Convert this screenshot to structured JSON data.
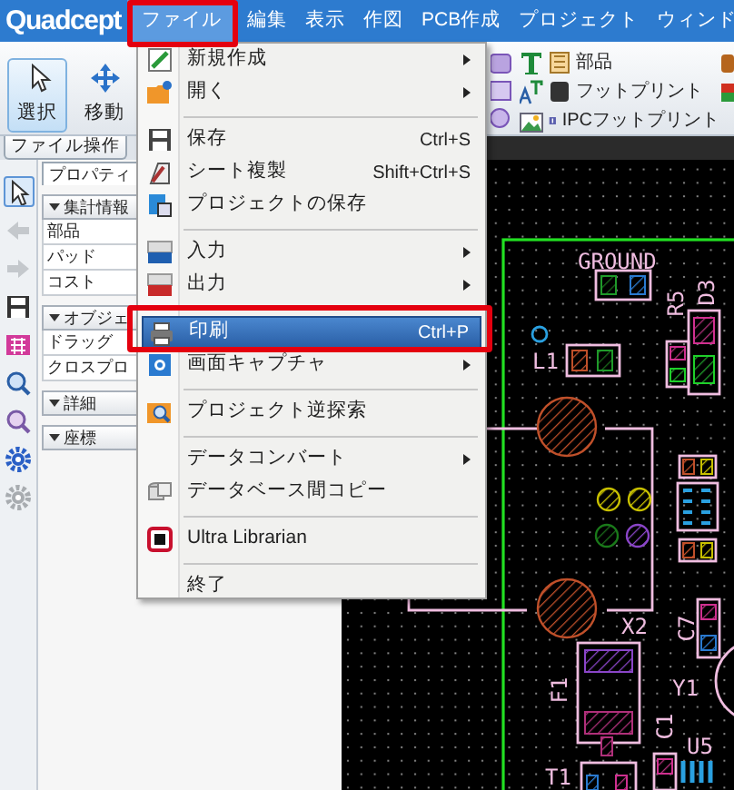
{
  "app": {
    "logo": "Quadcept"
  },
  "menubar": [
    {
      "label": "ファイル",
      "selected": true
    },
    {
      "label": "編集",
      "selected": false
    },
    {
      "label": "表示",
      "selected": false
    },
    {
      "label": "作図",
      "selected": false
    },
    {
      "label": "PCB作成",
      "selected": false
    },
    {
      "label": "プロジェクト",
      "selected": false
    },
    {
      "label": "ウィンド",
      "selected": false
    }
  ],
  "ribbon": {
    "tools": [
      {
        "kind": "select",
        "label": "選択",
        "selected": true
      },
      {
        "kind": "move",
        "label": "移動",
        "selected": false
      }
    ],
    "group_label": "ファイル操作",
    "library_items": [
      "部品",
      "フットプリント",
      "IPCフットプリント"
    ]
  },
  "side_tools": [
    {
      "kind": "pointer",
      "selected": true
    },
    {
      "kind": "back",
      "selected": false
    },
    {
      "kind": "forward",
      "selected": false
    },
    {
      "kind": "save",
      "selected": false
    },
    {
      "kind": "grid",
      "selected": false
    },
    {
      "kind": "zoom-in",
      "selected": false
    },
    {
      "kind": "zoom-out",
      "selected": false
    },
    {
      "kind": "gear",
      "selected": false
    },
    {
      "kind": "gear-dim",
      "selected": false
    }
  ],
  "panel": {
    "tab": "プロパティ",
    "sections": [
      {
        "title": "集計情報",
        "rows": [
          "部品",
          "パッド",
          "コスト"
        ]
      },
      {
        "title": "オブジェ",
        "rows": [
          "ドラッグ",
          "クロスプロ"
        ]
      },
      {
        "title": "詳細"
      },
      {
        "title": "座標"
      }
    ]
  },
  "file_menu": {
    "items": [
      {
        "kind": "item",
        "label": "新規作成",
        "submenu": true,
        "selected": false
      },
      {
        "kind": "item",
        "label": "開く",
        "submenu": true,
        "selected": false
      },
      {
        "kind": "separator"
      },
      {
        "kind": "item",
        "label": "保存",
        "shortcut": "Ctrl+S",
        "submenu": false,
        "selected": false
      },
      {
        "kind": "item",
        "label": "シート複製",
        "shortcut": "Shift+Ctrl+S",
        "submenu": false,
        "selected": false
      },
      {
        "kind": "item",
        "label": "プロジェクトの保存",
        "submenu": false,
        "selected": false
      },
      {
        "kind": "separator"
      },
      {
        "kind": "item",
        "label": "入力",
        "submenu": true,
        "selected": false
      },
      {
        "kind": "item",
        "label": "出力",
        "submenu": true,
        "selected": false
      },
      {
        "kind": "separator"
      },
      {
        "kind": "item",
        "label": "印刷",
        "shortcut": "Ctrl+P",
        "submenu": false,
        "selected": true
      },
      {
        "kind": "item",
        "label": "画面キャプチャ",
        "submenu": true,
        "selected": false
      },
      {
        "kind": "separator"
      },
      {
        "kind": "item",
        "label": "プロジェクト逆探索",
        "submenu": false,
        "selected": false
      },
      {
        "kind": "separator"
      },
      {
        "kind": "item",
        "label": "データコンバート",
        "submenu": true,
        "selected": false
      },
      {
        "kind": "item",
        "label": "データベース間コピー",
        "submenu": false,
        "selected": false
      },
      {
        "kind": "separator"
      },
      {
        "kind": "item",
        "label": "Ultra Librarian",
        "submenu": false,
        "selected": false
      },
      {
        "kind": "separator"
      },
      {
        "kind": "item",
        "label": "終了",
        "submenu": false,
        "selected": false
      }
    ]
  },
  "canvas": {
    "labels": [
      "GROUND",
      "L1",
      "R5",
      "D3",
      "X2",
      "C7",
      "Y1",
      "F1",
      "C1",
      "U5",
      "T1"
    ]
  }
}
